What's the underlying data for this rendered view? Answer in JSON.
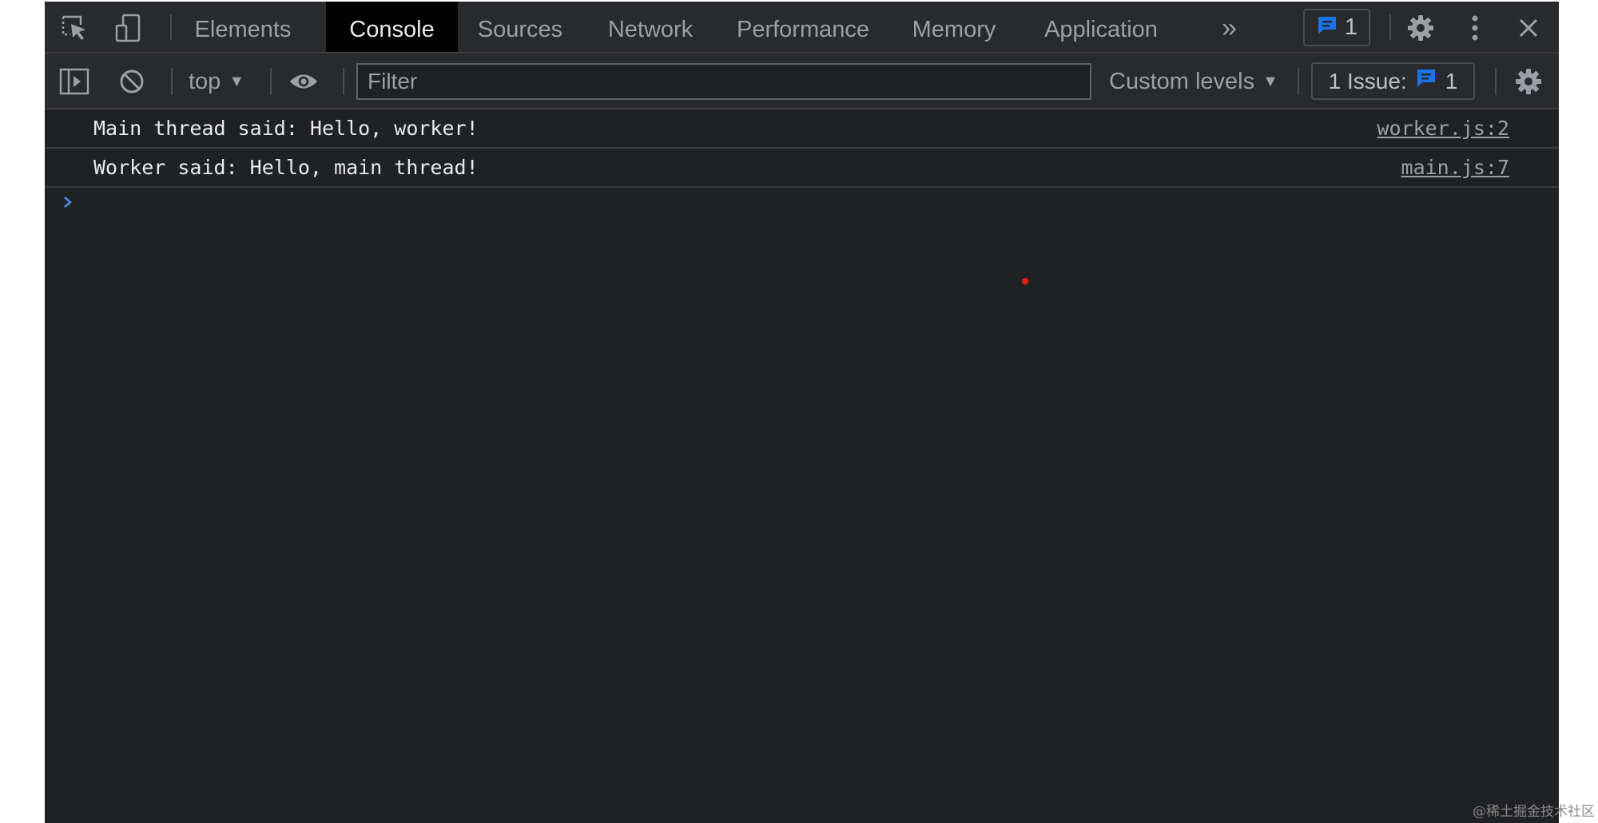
{
  "tabs": [
    {
      "label": "Elements",
      "active": false
    },
    {
      "label": "Console",
      "active": true
    },
    {
      "label": "Sources",
      "active": false
    },
    {
      "label": "Network",
      "active": false
    },
    {
      "label": "Performance",
      "active": false
    },
    {
      "label": "Memory",
      "active": false
    },
    {
      "label": "Application",
      "active": false
    }
  ],
  "more_tabs_glyph": "»",
  "message_count": "1",
  "toolbar": {
    "context": "top",
    "filter_placeholder": "Filter",
    "levels": "Custom levels",
    "issues_label": "1 Issue:",
    "issues_count": "1"
  },
  "messages": [
    {
      "text": "Main thread said: Hello, worker!",
      "source": "worker.js:2"
    },
    {
      "text": "Worker said: Hello, main thread!",
      "source": "main.js:7"
    }
  ],
  "prompt_glyph": "›",
  "watermark": "@稀土掘金技术社区",
  "colors": {
    "background": "#202124",
    "toolbar": "#292a2d",
    "active_tab": "#000000",
    "text": "#e8eaed",
    "muted": "#9aa0a6",
    "accent_blue": "#1a73e8",
    "prompt_blue": "#4a90e2"
  }
}
